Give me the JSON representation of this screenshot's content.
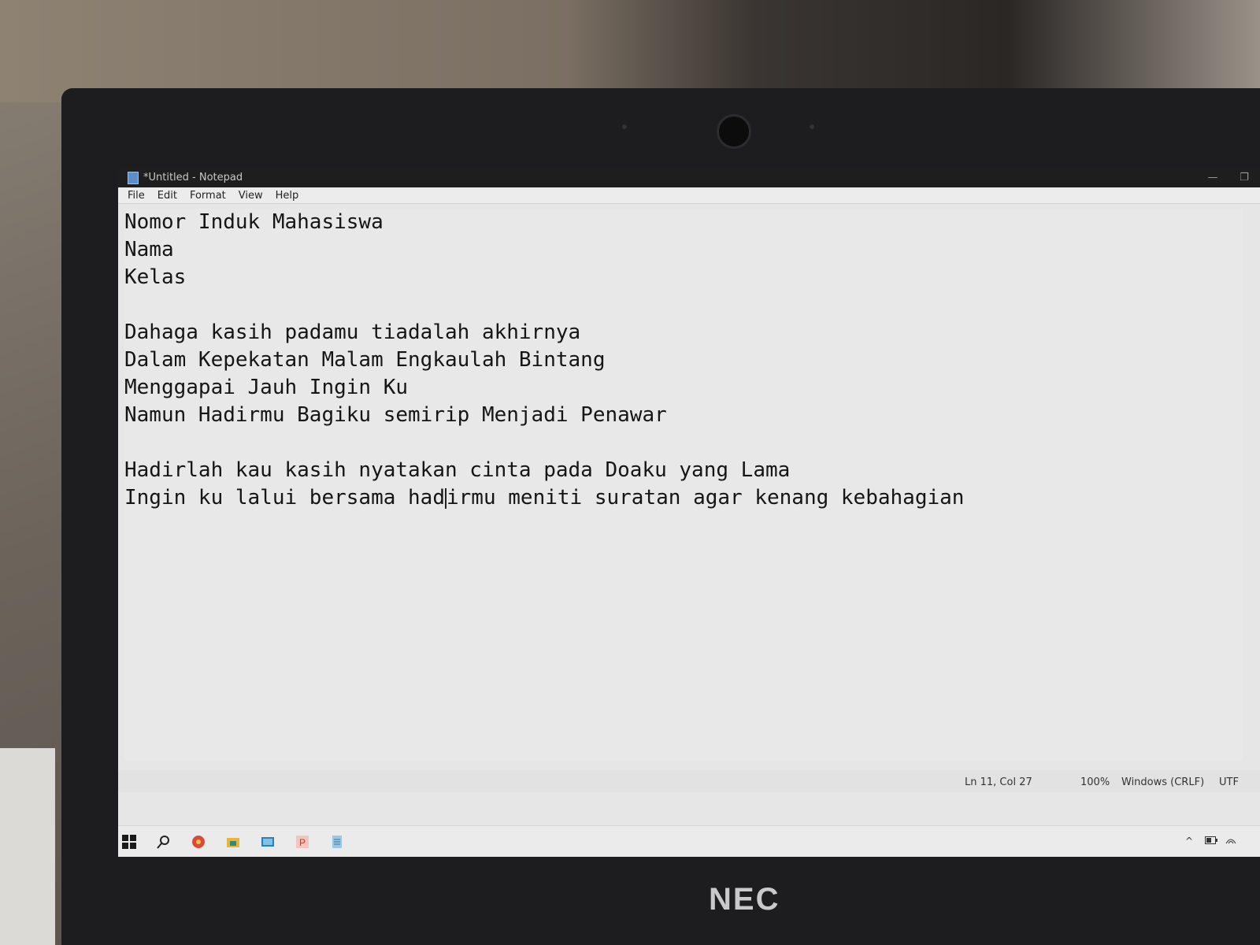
{
  "window": {
    "title": "*Untitled - Notepad",
    "minimize_glyph": "—",
    "restore_glyph": "❐"
  },
  "menu": {
    "file": "File",
    "edit": "Edit",
    "format": "Format",
    "view": "View",
    "help": "Help"
  },
  "document": {
    "lines": [
      "Nomor Induk Mahasiswa",
      "Nama",
      "Kelas",
      "",
      "Dahaga kasih padamu tiadalah akhirnya",
      "Dalam Kepekatan Malam Engkaulah Bintang",
      "Menggapai Jauh Ingin Ku",
      "Namun Hadirmu Bagiku semirip Menjadi Penawar",
      "",
      "Hadirlah kau kasih nyatakan cinta pada Doaku yang Lama"
    ],
    "last_line_before_caret": "Ingin ku lalui bersama had",
    "last_line_after_caret": "irmu meniti suratan agar kenang kebahagian"
  },
  "status": {
    "position": "Ln 11, Col 27",
    "zoom": "100%",
    "line_ending": "Windows (CRLF)",
    "encoding": "UTF"
  },
  "taskbar": {
    "icons": [
      "windows-start-icon",
      "search-icon",
      "browser-icon",
      "file-explorer-icon",
      "control-panel-icon",
      "powerpoint-icon",
      "notepad-icon"
    ],
    "tray_chevron": "^"
  },
  "laptop": {
    "brand": "NEC"
  }
}
